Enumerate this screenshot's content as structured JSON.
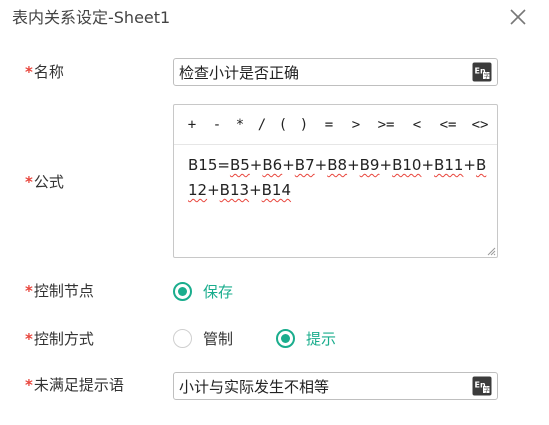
{
  "dialog": {
    "title": "表内关系设定-Sheet1"
  },
  "fields": {
    "name_label": "名称",
    "name_value": "检查小计是否正确",
    "formula_label": "公式",
    "formula_prefix": "B15=",
    "formula_tokens": [
      "B5",
      "+",
      "B6",
      "+",
      "B7",
      "+",
      "B8",
      "+",
      "B9",
      "+",
      "B10",
      "+",
      "B11",
      "+",
      "B12",
      "+",
      "B13",
      "+",
      "B14"
    ],
    "control_node_label": "控制节点",
    "control_node_option": "保存",
    "control_mode_label": "控制方式",
    "control_mode_options": [
      "管制",
      "提示"
    ],
    "control_mode_selected": "提示",
    "message_label": "未满足提示语",
    "message_value": "小计与实际发生不相等",
    "required_mark": "*"
  },
  "operators": [
    "+",
    "-",
    "*",
    "/",
    "(",
    ")",
    "=",
    ">",
    ">=",
    "<",
    "<=",
    "<>"
  ],
  "colors": {
    "accent": "#1aad8d",
    "required": "#e8453c",
    "spellcheck": "#e8453c"
  },
  "icons": {
    "close": "close-icon",
    "input_method": "en-input-method-icon"
  }
}
